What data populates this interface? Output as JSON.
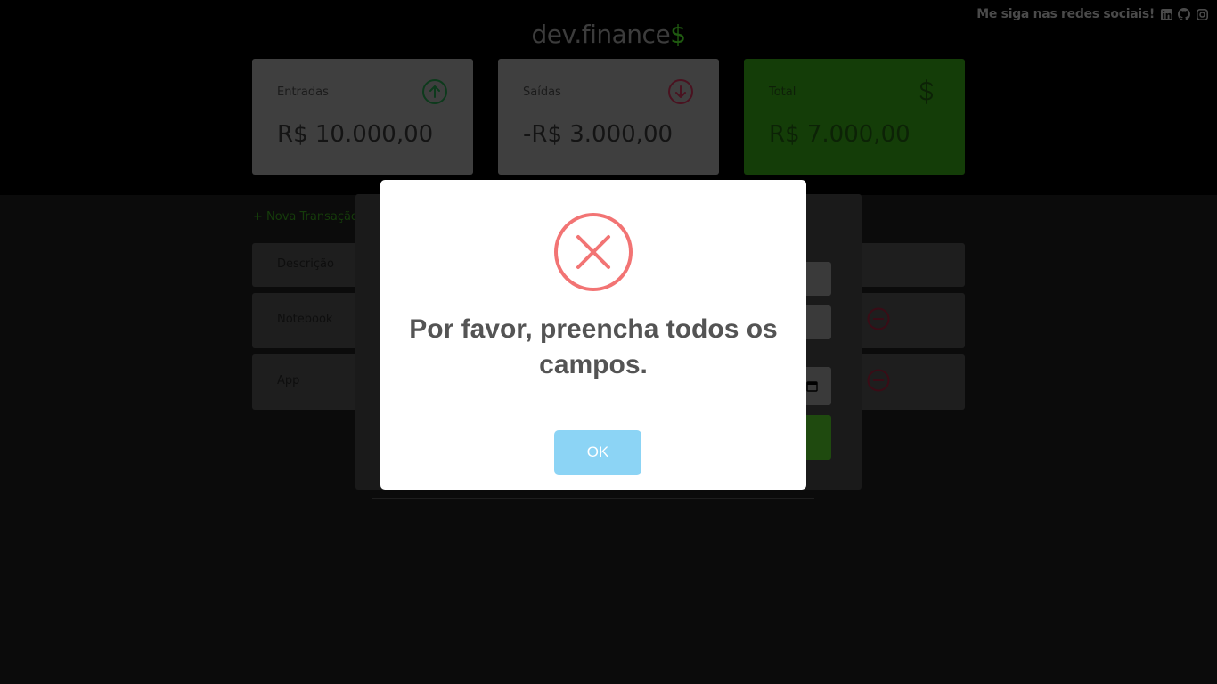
{
  "header": {
    "social_text": "Me siga nas redes sociais!",
    "social_icons": [
      "linkedin-icon",
      "github-icon",
      "instagram-icon"
    ],
    "logo_text": "dev.finance",
    "logo_suffix": "$"
  },
  "cards": {
    "income": {
      "label": "Entradas",
      "value": "R$ 10.000,00",
      "icon": "arrow-up-circle-icon"
    },
    "expense": {
      "label": "Saídas",
      "value": "-R$ 3.000,00",
      "icon": "arrow-down-circle-icon"
    },
    "total": {
      "label": "Total",
      "value": "R$ 7.000,00",
      "icon": "dollar-icon"
    }
  },
  "transactions": {
    "new_label": "+ Nova Transação",
    "header_col": "Descrição",
    "rows": [
      {
        "description": "Notebook"
      },
      {
        "description": "App"
      }
    ]
  },
  "alert": {
    "icon": "error-x-icon",
    "message": "Por favor, preencha todos os campos.",
    "ok_label": "OK"
  },
  "colors": {
    "alert_icon": "#f27474",
    "ok_button": "#8cd4f5",
    "total_card": "#143d08"
  }
}
